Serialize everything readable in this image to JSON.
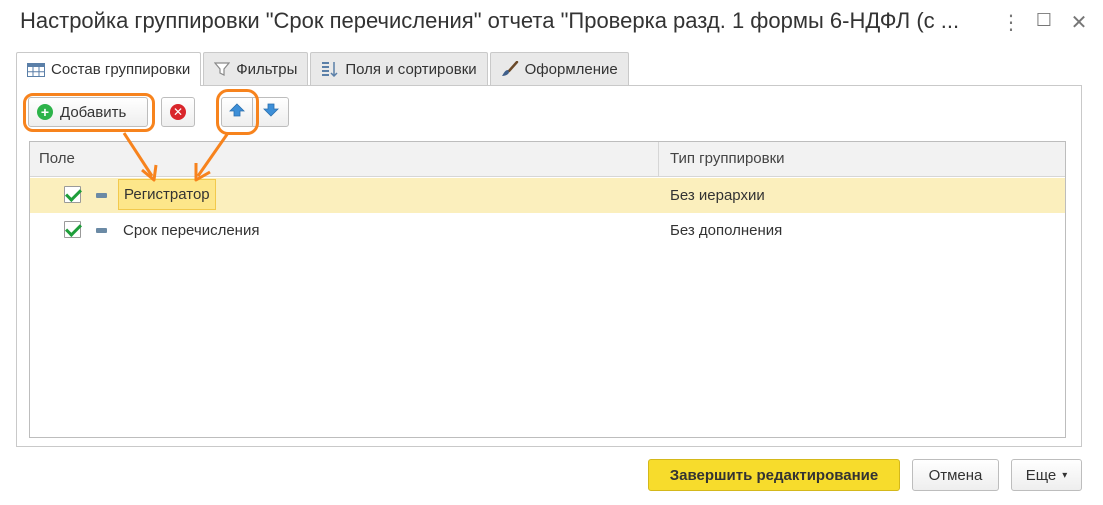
{
  "window": {
    "title": "Настройка группировки \"Срок перечисления\" отчета \"Проверка разд. 1 формы 6-НДФЛ (с ...",
    "more_glyph": "⋮",
    "maximize_glyph": "☐",
    "close_glyph": "✕"
  },
  "tabs": [
    {
      "label": "Состав группировки",
      "icon": "table-icon",
      "active": true
    },
    {
      "label": "Фильтры",
      "icon": "filter-icon",
      "active": false
    },
    {
      "label": "Поля и сортировки",
      "icon": "fields-sort-icon",
      "active": false
    },
    {
      "label": "Оформление",
      "icon": "brush-icon",
      "active": false
    }
  ],
  "toolbar": {
    "add_label": "Добавить",
    "add_icon": "plus-circle-icon",
    "delete_icon": "delete-x-icon",
    "move_up_icon": "arrow-up-icon",
    "move_down_icon": "arrow-down-icon"
  },
  "grid": {
    "columns": [
      "Поле",
      "Тип группировки"
    ],
    "rows": [
      {
        "checked": true,
        "field": "Регистратор",
        "type": "Без иерархии",
        "selected": true
      },
      {
        "checked": true,
        "field": "Срок перечисления",
        "type": "Без дополнения",
        "selected": false
      }
    ]
  },
  "footer": {
    "finish_label": "Завершить редактирование",
    "cancel_label": "Отмена",
    "more_label": "Еще",
    "more_caret": "▾"
  },
  "colors": {
    "accent_yellow": "#f7dc2c",
    "highlight_orange": "#f7831d",
    "selected_row": "#fbefbd"
  }
}
